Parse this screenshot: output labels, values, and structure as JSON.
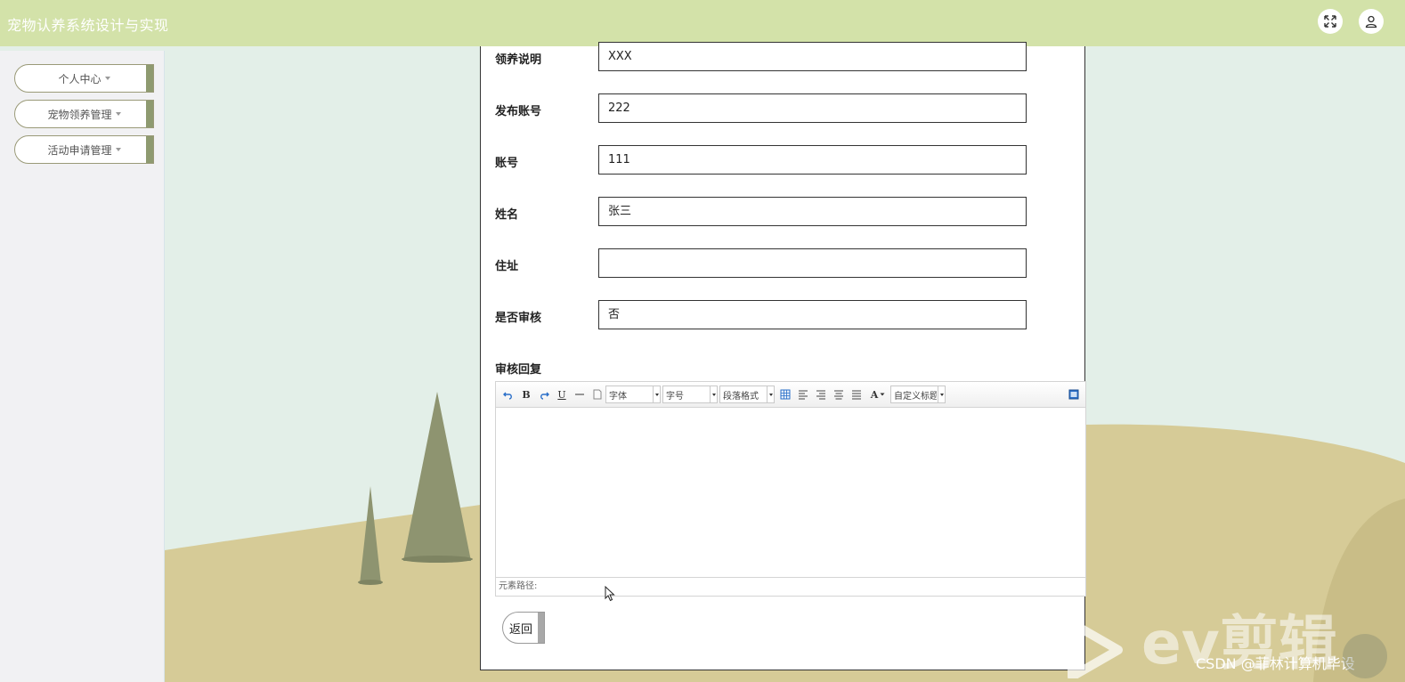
{
  "header": {
    "title": "宠物认养系统设计与实现",
    "fullscreen_icon": "expand-icon",
    "user_icon": "user-icon"
  },
  "sidebar": {
    "items": [
      {
        "label": "个人中心"
      },
      {
        "label": "宠物领养管理"
      },
      {
        "label": "活动申请管理"
      }
    ]
  },
  "form": {
    "fields": [
      {
        "label": "领养说明",
        "value": "XXX"
      },
      {
        "label": "发布账号",
        "value": "222"
      },
      {
        "label": "账号",
        "value": "111"
      },
      {
        "label": "姓名",
        "value": "张三"
      },
      {
        "label": "住址",
        "value": ""
      },
      {
        "label": "是否审核",
        "value": "否"
      }
    ],
    "reply_label": "审核回复",
    "editor": {
      "font_family": "字体",
      "font_size": "字号",
      "paragraph": "段落格式",
      "custom_title": "自定义标题",
      "bold": "B",
      "underline": "U",
      "font_color": "A",
      "status": "元素路径:"
    },
    "back_label": "返回"
  },
  "watermark": {
    "brand": "ev剪辑",
    "csdn": "CSDN @菲林计算机毕设"
  },
  "colors": {
    "header_bg": "#d3e2a9",
    "sidebar_bg": "#f1f1f3",
    "accent": "#8e9a70",
    "sky": "#e3efe8",
    "hill": "#d6cb97"
  }
}
